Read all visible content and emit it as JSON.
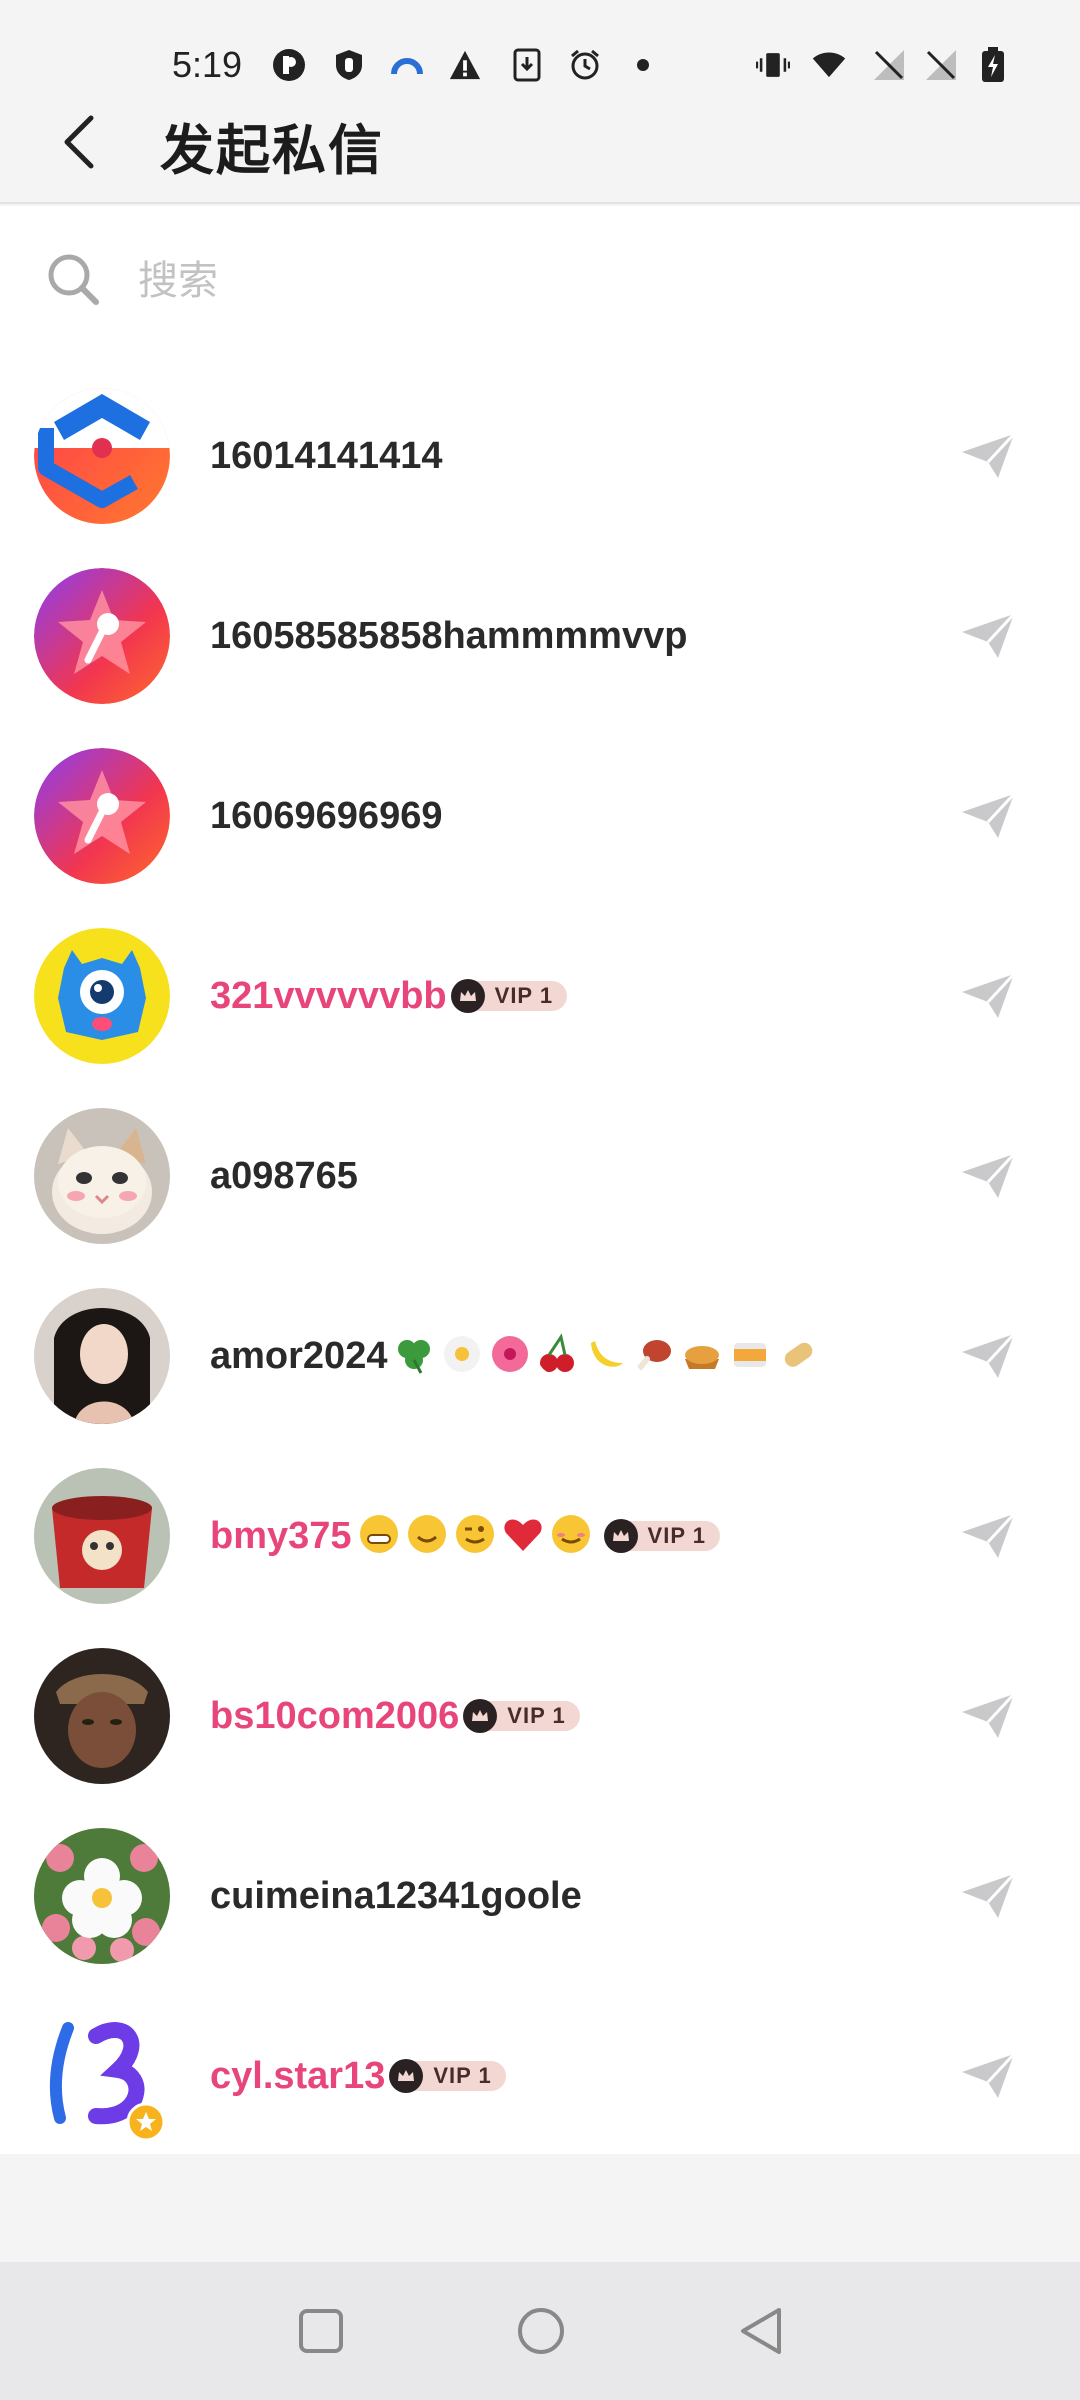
{
  "status_bar": {
    "time": "5:19"
  },
  "header": {
    "title": "发起私信",
    "back_icon": "chevron-left-icon"
  },
  "search": {
    "placeholder": "搜索",
    "value": ""
  },
  "contacts": [
    {
      "name": "16014141414",
      "vip": false
    },
    {
      "name": "16058585858hammmmvvp",
      "vip": false
    },
    {
      "name": "16069696969",
      "vip": false
    },
    {
      "name": "321vvvvvvbb",
      "vip": true,
      "badge": "VIP 1"
    },
    {
      "name": "a098765",
      "vip": false
    },
    {
      "name": "amor2024",
      "vip": false
    },
    {
      "name": "bmy375",
      "vip": true,
      "badge": "VIP 1"
    },
    {
      "name": "bs10com2006",
      "vip": true,
      "badge": "VIP 1"
    },
    {
      "name": "cuimeina12341goole",
      "vip": false
    },
    {
      "name": "cyl.star13",
      "vip": true,
      "badge": "VIP 1"
    }
  ],
  "colors": {
    "vip_name": "#e8457a",
    "normal_name": "#2a2a2a",
    "send_icon": "#c9c9cb"
  }
}
